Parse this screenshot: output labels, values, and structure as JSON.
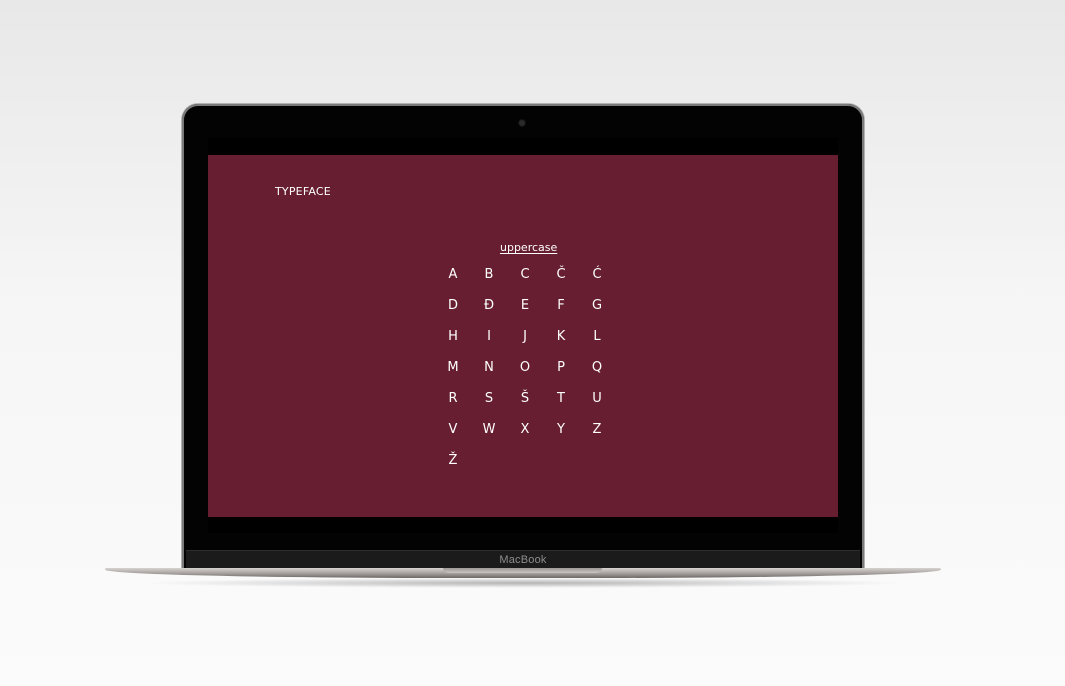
{
  "device": {
    "brand_label": "MacBook"
  },
  "page": {
    "background_color": "#661e30",
    "text_color": "#ffffff",
    "title": "TYPEFACE",
    "section_label": "uppercase",
    "letters": [
      "A",
      "B",
      "C",
      "Č",
      "Ć",
      "D",
      "Đ",
      "E",
      "F",
      "G",
      "H",
      "I",
      "J",
      "K",
      "L",
      "M",
      "N",
      "O",
      "P",
      "Q",
      "R",
      "S",
      "Š",
      "T",
      "U",
      "V",
      "W",
      "X",
      "Y",
      "Z",
      "Ž"
    ]
  }
}
